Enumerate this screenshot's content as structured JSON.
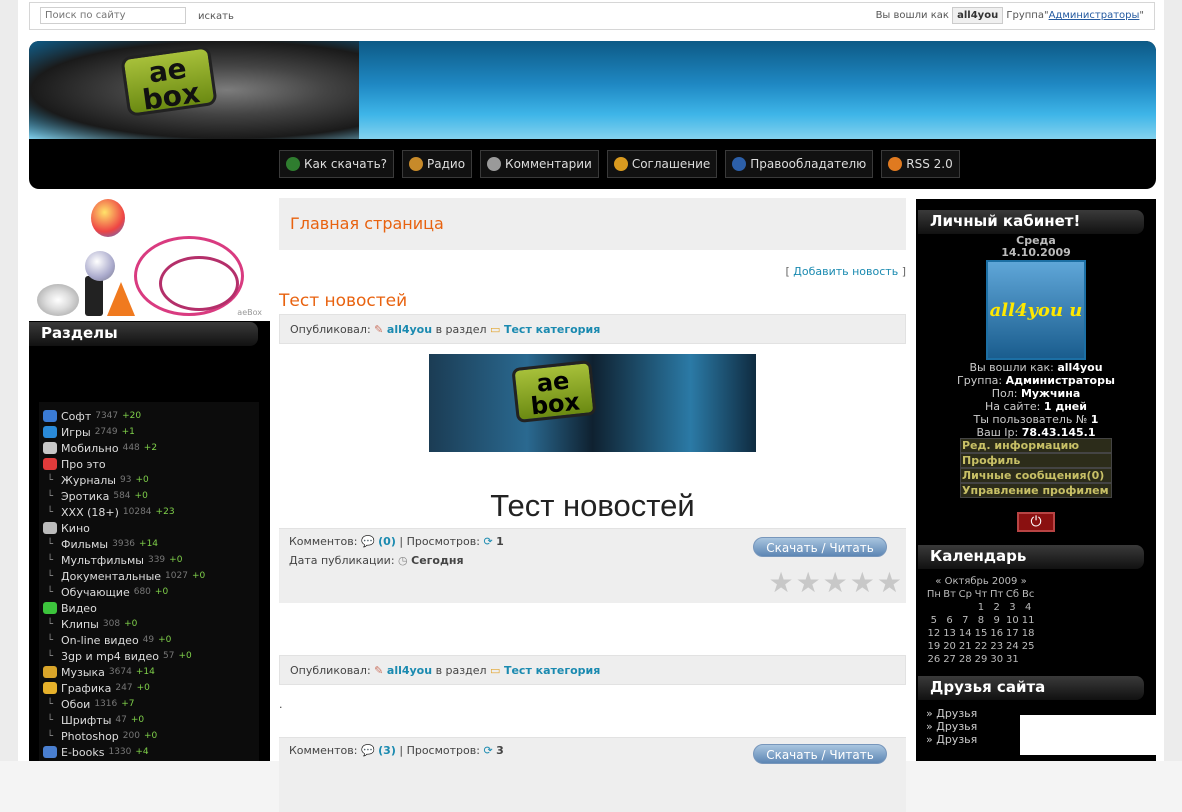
{
  "topbar": {
    "search_placeholder": "Поиск по сайту",
    "search_button": "искать",
    "login_prefix": "Вы вошли как",
    "username": "all4you",
    "group_prefix": "Группа\"",
    "group_name": "Администраторы",
    "group_suffix": "\""
  },
  "banner": {
    "logo_text": "ae box"
  },
  "nav": {
    "items": [
      {
        "label": "Как скачать?",
        "icon": "download-icon",
        "color": "#2f7d2f"
      },
      {
        "label": "Радио",
        "icon": "radio-icon",
        "color": "#c78a2a"
      },
      {
        "label": "Комментарии",
        "icon": "comment-icon",
        "color": "#9a9a9a"
      },
      {
        "label": "Соглашение",
        "icon": "warning-icon",
        "color": "#d99a1f"
      },
      {
        "label": "Правообладателю",
        "icon": "info-icon",
        "color": "#2c5fa8"
      },
      {
        "label": "RSS 2.0",
        "icon": "rss-icon",
        "color": "#e07a20"
      }
    ]
  },
  "left": {
    "logo_text": "aeBox",
    "section_title": "Разделы",
    "items": [
      {
        "label": "Софт",
        "count": "7347",
        "delta": "+20",
        "level": 0,
        "icon": "gear-icon",
        "color": "#3a7bd5"
      },
      {
        "label": "Игры",
        "count": "2749",
        "delta": "+1",
        "level": 0,
        "icon": "joystick-icon",
        "color": "#2a8ad8"
      },
      {
        "label": "Мобильно",
        "count": "448",
        "delta": "+2",
        "level": 0,
        "icon": "phone-icon",
        "color": "#c7c7c7"
      },
      {
        "label": "Про это",
        "count": "",
        "delta": "",
        "level": 0,
        "icon": "heart-icon",
        "color": "#e03b3b"
      },
      {
        "label": "Журналы",
        "count": "93",
        "delta": "+0",
        "level": 1
      },
      {
        "label": "Эротика",
        "count": "584",
        "delta": "+0",
        "level": 1
      },
      {
        "label": "XXX (18+)",
        "count": "10284",
        "delta": "+23",
        "level": 1
      },
      {
        "label": "Кино",
        "count": "",
        "delta": "",
        "level": 0,
        "icon": "film-reel-icon",
        "color": "#bbbbbb"
      },
      {
        "label": "Фильмы",
        "count": "3936",
        "delta": "+14",
        "level": 1
      },
      {
        "label": "Мультфильмы",
        "count": "339",
        "delta": "+0",
        "level": 1
      },
      {
        "label": "Документальные",
        "count": "1027",
        "delta": "+0",
        "level": 1
      },
      {
        "label": "Обучающие",
        "count": "680",
        "delta": "+0",
        "level": 1
      },
      {
        "label": "Видео",
        "count": "",
        "delta": "",
        "level": 0,
        "icon": "play-icon",
        "color": "#3cc43c"
      },
      {
        "label": "Клипы",
        "count": "308",
        "delta": "+0",
        "level": 1
      },
      {
        "label": "On-line видео",
        "count": "49",
        "delta": "+0",
        "level": 1
      },
      {
        "label": "3gp и mp4 видео",
        "count": "57",
        "delta": "+0",
        "level": 1
      },
      {
        "label": "Музыка",
        "count": "3674",
        "delta": "+14",
        "level": 0,
        "icon": "music-icon",
        "color": "#d9a52a"
      },
      {
        "label": "Графика",
        "count": "247",
        "delta": "+0",
        "level": 0,
        "icon": "palette-icon",
        "color": "#e6b12b"
      },
      {
        "label": "Обои",
        "count": "1316",
        "delta": "+7",
        "level": 1
      },
      {
        "label": "Шрифты",
        "count": "47",
        "delta": "+0",
        "level": 1
      },
      {
        "label": "Photoshop",
        "count": "200",
        "delta": "+0",
        "level": 1
      },
      {
        "label": "E-books",
        "count": "1330",
        "delta": "+4",
        "level": 0,
        "icon": "book-icon",
        "color": "#4a7fd0"
      }
    ]
  },
  "center": {
    "page_title": "Главная страница",
    "add_news_open": "[ ",
    "add_news_label": "Добавить новость",
    "add_news_close": " ]",
    "posts": [
      {
        "title": "Тест новостей",
        "by_label": "Опубликовал:",
        "author": "all4you",
        "in_label": "в раздел",
        "category": "Тест категория",
        "image_logo_text": "ae box",
        "big_title": "Тест новостей",
        "comments_label": "Комментов:",
        "comments": "(0)",
        "sep": "|",
        "views_label": "Просмотров:",
        "views": "1",
        "date_label": "Дата публикации:",
        "date": "Сегодня",
        "button": "Скачать / Читать",
        "rating": 0
      },
      {
        "by_label": "Опубликовал:",
        "author": "all4you",
        "in_label": "в раздел",
        "category": "Тест категория",
        "body": ".",
        "comments_label": "Комментов:",
        "comments": "(3)",
        "sep": "|",
        "views_label": "Просмотров:",
        "views": "3",
        "button": "Скачать / Читать"
      }
    ]
  },
  "right": {
    "cabinet_title": "Личный кабинет!",
    "weekday": "Среда",
    "date": "14.10.2009",
    "avatar_text": "all4you и",
    "login_label": "Вы вошли как:",
    "login_value": "all4you",
    "group_label": "Группа:",
    "group_value": "Администраторы",
    "sex_label": "Пол:",
    "sex_value": "Мужчина",
    "online_label": "На сайте:",
    "online_value": "1 дней",
    "user_no_label": "Ты пользователь №",
    "user_no_value": "1",
    "ip_label": "Ваш Ip:",
    "ip_value": "78.43.145.1",
    "menu": [
      "Ред. информацию",
      "Профиль",
      "Личные сообщения(0)",
      "Управление профилем"
    ],
    "logout_symbol": "⏻",
    "calendar_title": "Календарь",
    "cal_prev": "«",
    "cal_month": "Октябрь 2009",
    "cal_next": "»",
    "weekdays": [
      "Пн",
      "Вт",
      "Ср",
      "Чт",
      "Пт",
      "Сб",
      "Вс"
    ],
    "days": [
      "",
      "",
      "",
      "1",
      "2",
      "3",
      "4",
      "5",
      "6",
      "7",
      "8",
      "9",
      "10",
      "11",
      "12",
      "13",
      "14",
      "15",
      "16",
      "17",
      "18",
      "19",
      "20",
      "21",
      "22",
      "23",
      "24",
      "25",
      "26",
      "27",
      "28",
      "29",
      "30",
      "31",
      ""
    ],
    "friends_title": "Друзья сайта",
    "friends": [
      "» Друзья",
      "» Друзья",
      "» Друзья"
    ]
  }
}
